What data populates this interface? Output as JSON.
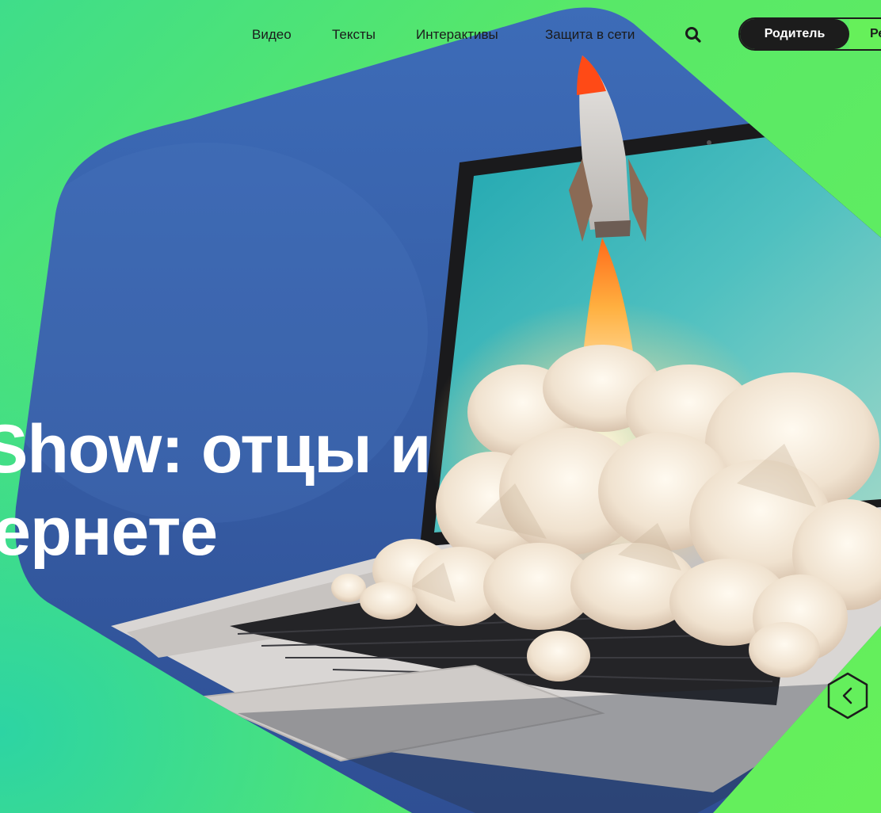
{
  "nav": {
    "links": [
      "Видео",
      "Тексты",
      "Интерактивы",
      "Защита в сети"
    ]
  },
  "role_toggle": {
    "active": "Родитель",
    "inactive": "Ре"
  },
  "hero": {
    "title_line1": "Show: отцы и",
    "title_line2": "тернете"
  },
  "icons": {
    "search": "search-icon",
    "prev": "chevron-left-icon"
  },
  "colors": {
    "accent_green": "#66f05a",
    "dark": "#1c1c1c",
    "hero_blue": "#3a5ba8"
  }
}
